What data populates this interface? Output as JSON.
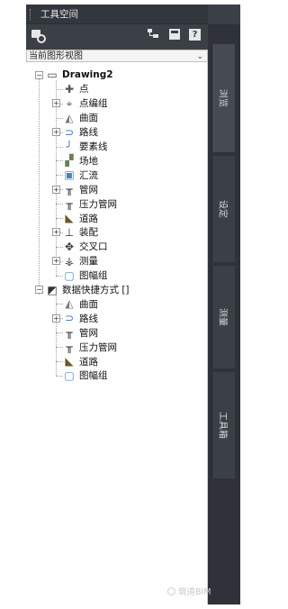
{
  "window": {
    "title": "工具空间"
  },
  "dropdown": {
    "selected": "当前图形视图",
    "chevron": "⌄"
  },
  "toolbar": {
    "help_label": "?"
  },
  "tree": {
    "root_label": "Drawing2",
    "items": [
      {
        "label": "点",
        "icon": "point-icon"
      },
      {
        "label": "点编组",
        "icon": "point-group-icon",
        "expander": "+"
      },
      {
        "label": "曲面",
        "icon": "surface-icon"
      },
      {
        "label": "路线",
        "icon": "alignment-icon",
        "expander": "+"
      },
      {
        "label": "要素线",
        "icon": "feature-line-icon"
      },
      {
        "label": "场地",
        "icon": "site-icon"
      },
      {
        "label": "汇流",
        "icon": "catchment-icon"
      },
      {
        "label": "管网",
        "icon": "pipe-network-icon",
        "expander": "+"
      },
      {
        "label": "压力管网",
        "icon": "pressure-network-icon"
      },
      {
        "label": "道路",
        "icon": "corridor-icon"
      },
      {
        "label": "装配",
        "icon": "assembly-icon",
        "expander": "+"
      },
      {
        "label": "交叉口",
        "icon": "intersection-icon"
      },
      {
        "label": "测量",
        "icon": "survey-icon",
        "expander": "+"
      },
      {
        "label": "图幅组",
        "icon": "view-frame-icon"
      }
    ],
    "shortcut_root_label": "数据快捷方式 []",
    "shortcut_items": [
      {
        "label": "曲面",
        "icon": "surface-shortcut-icon"
      },
      {
        "label": "路线",
        "icon": "alignment-shortcut-icon",
        "expander": "+"
      },
      {
        "label": "管网",
        "icon": "pipe-network-shortcut-icon"
      },
      {
        "label": "压力管网",
        "icon": "pressure-network-shortcut-icon"
      },
      {
        "label": "道路",
        "icon": "corridor-shortcut-icon"
      },
      {
        "label": "图幅组",
        "icon": "view-frame-shortcut-icon"
      }
    ]
  },
  "tabs": [
    {
      "label": "浏览"
    },
    {
      "label": "设定"
    },
    {
      "label": "测量"
    },
    {
      "label": "工具箱"
    }
  ],
  "watermark": {
    "text": "筑道BIM"
  },
  "colors": {
    "panel": "#3b3f46",
    "tab_strip": "#2f3238",
    "tree_bg": "#ffffff"
  }
}
